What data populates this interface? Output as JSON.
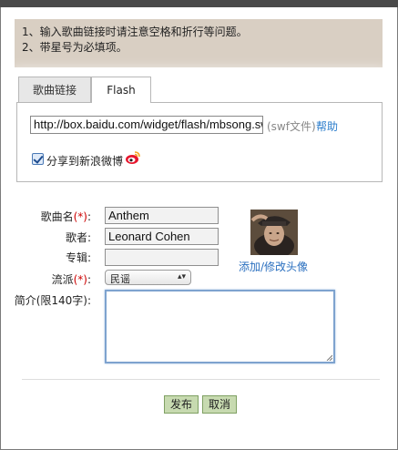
{
  "notice": {
    "line1": "1、输入歌曲链接时请注意空格和折行等问题。",
    "line2": "2、带星号为必填项。"
  },
  "tabs": [
    {
      "label": "歌曲链接",
      "active": false
    },
    {
      "label": "Flash",
      "active": true
    }
  ],
  "flash": {
    "url_value": "http://box.baidu.com/widget/flash/mbsong.swf",
    "swf_note": "(swf文件)",
    "help_label": "帮助",
    "share_label": "分享到新浪微博",
    "share_checked": true
  },
  "form": {
    "song_label": "歌曲名",
    "song_value": "Anthem",
    "singer_label": "歌者:",
    "singer_value": "Leonard Cohen",
    "album_label": "专辑:",
    "album_value": "",
    "genre_label": "流派",
    "genre_value": "民谣",
    "intro_label": "简介(限140字):",
    "intro_value": "",
    "required_mark": "(*)",
    "colon": ":"
  },
  "avatar": {
    "link_label": "添加/修改头像"
  },
  "buttons": {
    "submit": "发布",
    "cancel": "取消"
  },
  "colors": {
    "notice_bg": "#d9cfc3",
    "link": "#2a7ccb",
    "required": "#cc0000",
    "button_bg": "#c7dab0"
  }
}
